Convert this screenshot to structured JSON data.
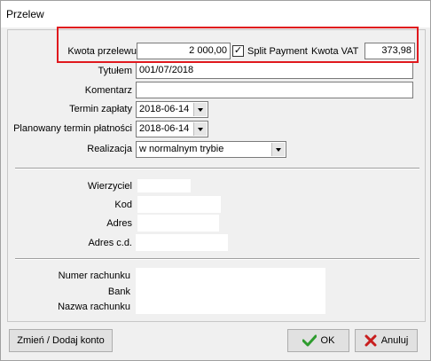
{
  "window": {
    "title": "Przelew"
  },
  "amount": {
    "label": "Kwota przelewu",
    "value": "2 000,00",
    "split_payment_label": "Split Payment",
    "split_payment_checked": true,
    "checkmark": "✓",
    "vat_label": "Kwota VAT",
    "vat_value": "373,98",
    "highlight_color": "#e0191e"
  },
  "form": {
    "title_label": "Tytułem",
    "title_value": "001/07/2018",
    "comment_label": "Komentarz",
    "comment_value": "",
    "payment_date_label": "Termin zapłaty",
    "payment_date_value": "2018-06-14",
    "planned_date_label": "Planowany termin płatności",
    "planned_date_value": "2018-06-14",
    "realization_label": "Realizacja",
    "realization_value": "w normalnym trybie"
  },
  "creditor": {
    "creditor_label": "Wierzyciel",
    "creditor_value": "",
    "code_label": "Kod",
    "code_value": "",
    "address_label": "Adres",
    "address_value": "",
    "address_cont_label": "Adres c.d.",
    "address_cont_value": ""
  },
  "account": {
    "number_label": "Numer rachunku",
    "number_value": "",
    "bank_label": "Bank",
    "bank_value": "",
    "name_label": "Nazwa rachunku",
    "name_value": ""
  },
  "buttons": {
    "change_account": "Zmień / Dodaj konto",
    "ok": "OK",
    "cancel": "Anuluj",
    "ok_color": "#2e9c2e",
    "cancel_color": "#c81e1e"
  }
}
